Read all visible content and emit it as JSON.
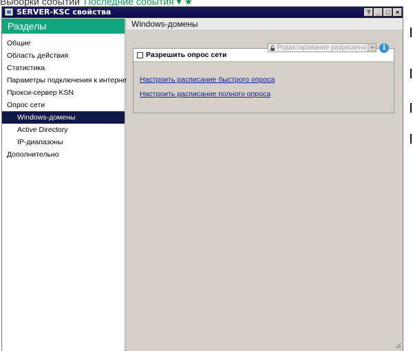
{
  "background": {
    "text": "Выборки событий",
    "link": "Последние события ▾ ★"
  },
  "window": {
    "title": "SERVER-KSC свойства",
    "help_label": "?",
    "minimize_label": "_",
    "maximize_label": "□",
    "close_label": "×"
  },
  "sidebar": {
    "header": "Разделы",
    "items": [
      {
        "label": "Общие"
      },
      {
        "label": "Область действия"
      },
      {
        "label": "Статистика"
      },
      {
        "label": "Параметры подключения к интернету"
      },
      {
        "label": "Прокси-сервер KSN"
      },
      {
        "label": "Опрос сети"
      },
      {
        "label": "Windows-домены"
      },
      {
        "label": "Active Directory"
      },
      {
        "label": "IP-диапазоны"
      },
      {
        "label": "Дополнительно"
      }
    ]
  },
  "main": {
    "header": "Windows-домены",
    "permission": "Редактирование разрешено",
    "info_label": "i",
    "enable_polling_label": "Разрешить опрос сети",
    "enable_polling_checked": false,
    "link_quick": "Настроить расписание быстрого опроса",
    "link_full": "Настроить расписание полного опроса"
  },
  "colors": {
    "sidebar_header": "#11a77c",
    "selected_item": "#0f1746",
    "title_bar": "#0a0a4a",
    "link": "#0a1f8f"
  }
}
